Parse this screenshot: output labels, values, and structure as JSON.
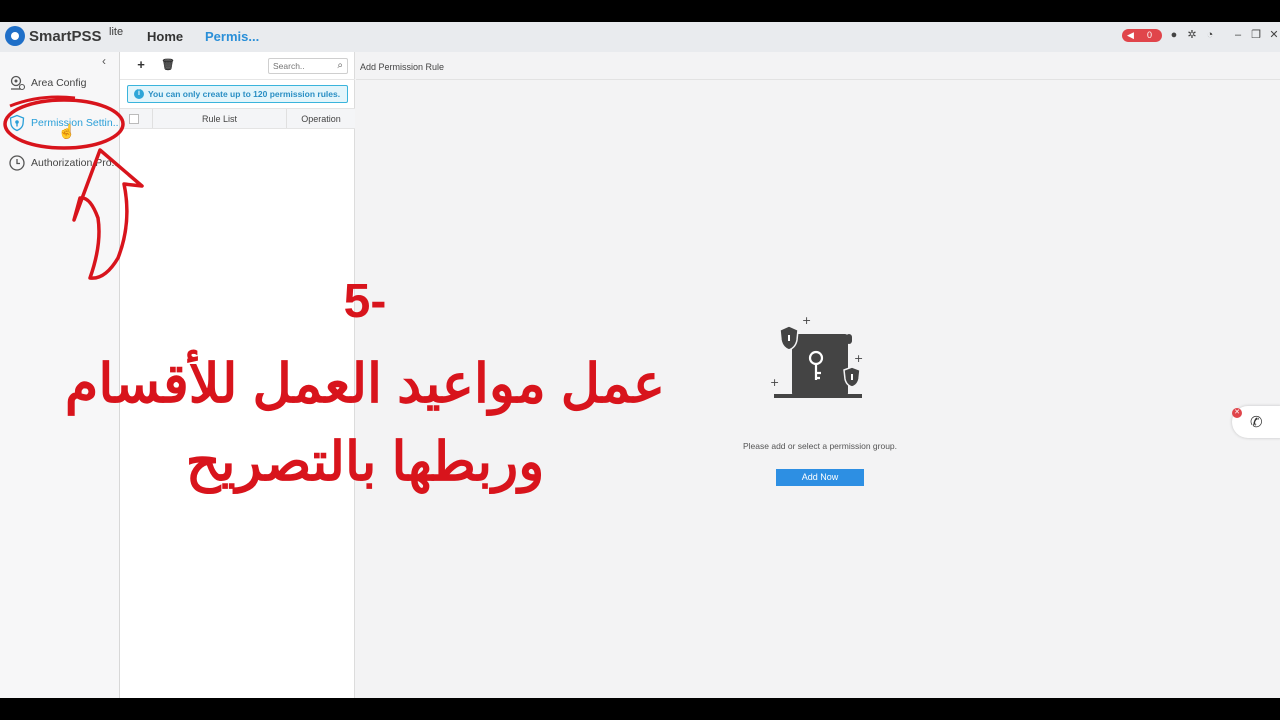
{
  "app": {
    "brand": "SmartPSS",
    "brand_sup": "lite",
    "nav_home": "Home",
    "nav_current": "Permis...",
    "alarm_count": "0"
  },
  "sidebar": {
    "items": [
      {
        "label": "Area Config",
        "icon": "area-config-icon"
      },
      {
        "label": "Permission Settin...",
        "icon": "shield-icon",
        "active": true
      },
      {
        "label": "Authorization Pro...",
        "icon": "clock-icon"
      }
    ]
  },
  "middle": {
    "search_placeholder": "Search..",
    "notice": "You can only create up to 120 permission rules.",
    "col_rule_list": "Rule List",
    "col_operation": "Operation"
  },
  "right": {
    "title": "Add Permission Rule",
    "empty_message": "Please add or select a permission group.",
    "add_button": "Add Now"
  },
  "annotation": {
    "step": "5-",
    "line1": "عمل مواعيد العمل للأقسام",
    "line2": "وربطها بالتصريح",
    "color": "#d8141c"
  },
  "colors": {
    "accent": "#2a8fd8",
    "button": "#2d8fe3",
    "alarm": "#e0454b"
  }
}
